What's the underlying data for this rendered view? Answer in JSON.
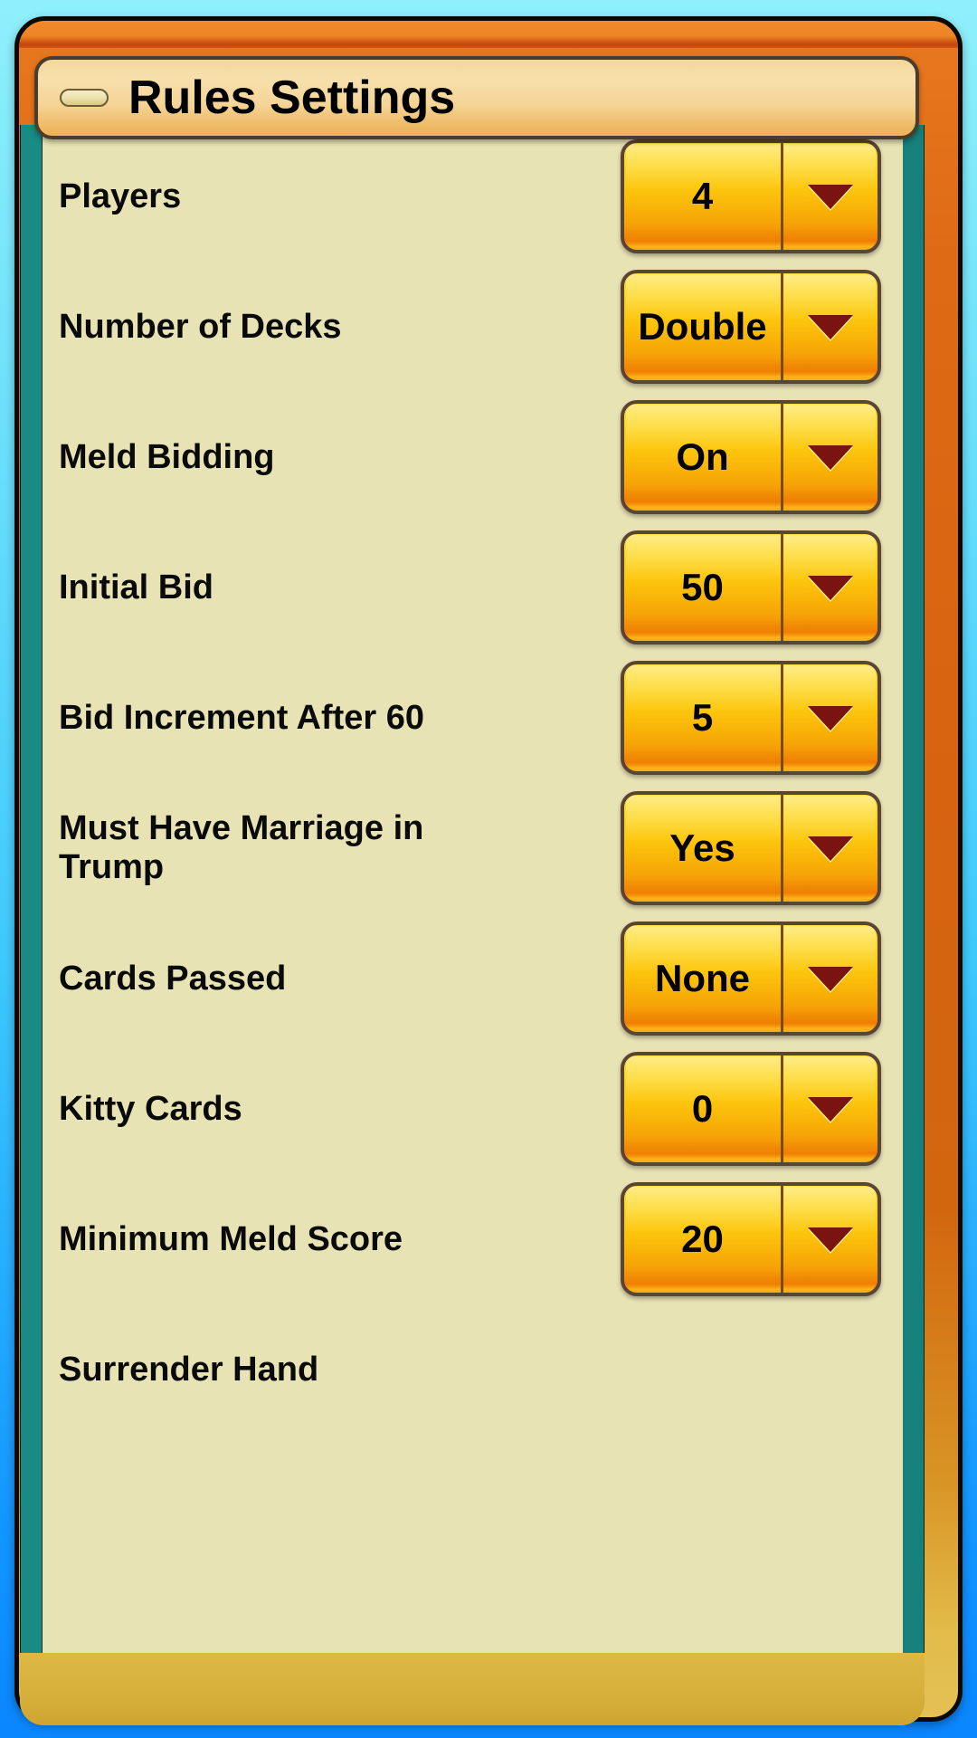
{
  "window": {
    "title": "Rules Settings",
    "collapse_icon": "minimize-dash-icon",
    "colors": {
      "background_top": "#8ff0fb",
      "background_bottom": "#0a86ff",
      "frame_orange": "#d7630f",
      "frame_gold": "#e4c155",
      "teal_border": "#17837d",
      "panel_cream": "#e8e3b4",
      "button_gold": "#fdc70e",
      "button_shadow_orange": "#ef7f04",
      "arrow_maroon": "#7a1410",
      "title_cream": "#f5d597"
    }
  },
  "settings": {
    "rows": [
      {
        "label": "Players",
        "value": "4",
        "icon": "chevron-down-icon"
      },
      {
        "label": "Number of Decks",
        "value": "Double",
        "icon": "chevron-down-icon"
      },
      {
        "label": "Meld Bidding",
        "value": "On",
        "icon": "chevron-down-icon"
      },
      {
        "label": "Initial Bid",
        "value": "50",
        "icon": "chevron-down-icon"
      },
      {
        "label": "Bid Increment After 60",
        "value": "5",
        "icon": "chevron-down-icon"
      },
      {
        "label": "Must Have Marriage in Trump",
        "value": "Yes",
        "icon": "chevron-down-icon"
      },
      {
        "label": "Cards Passed",
        "value": "None",
        "icon": "chevron-down-icon"
      },
      {
        "label": "Kitty Cards",
        "value": "0",
        "icon": "chevron-down-icon"
      },
      {
        "label": "Minimum Meld Score",
        "value": "20",
        "icon": "chevron-down-icon"
      },
      {
        "label": "Surrender Hand",
        "value": "",
        "icon": "chevron-down-icon"
      }
    ]
  }
}
